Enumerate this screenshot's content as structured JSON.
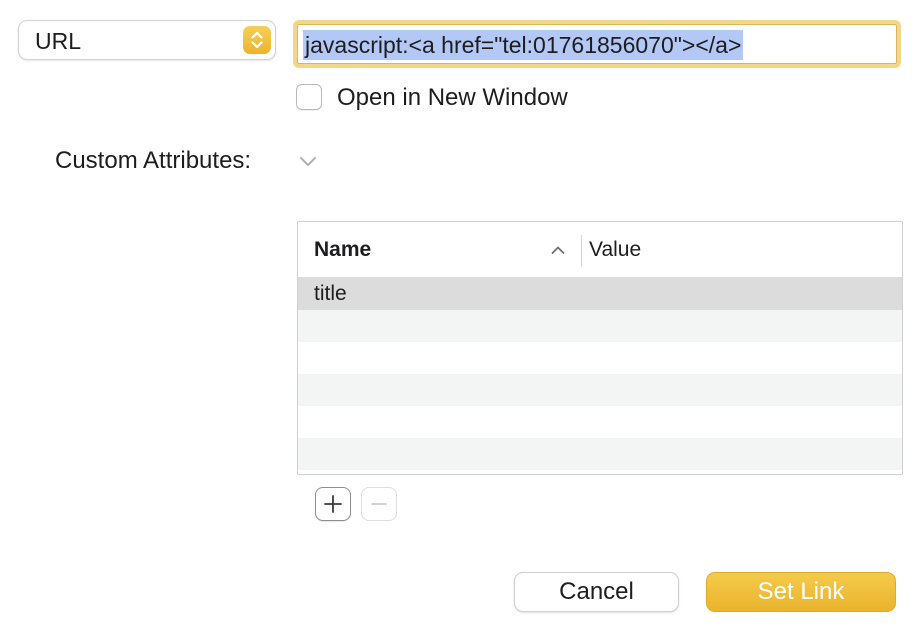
{
  "link_type": {
    "selected": "URL"
  },
  "url_field": {
    "value": "javascript:<a href=\"tel:01761856070\"></a>"
  },
  "open_in_new_window": {
    "label": "Open in New Window",
    "checked": false
  },
  "custom_attributes": {
    "label": "Custom Attributes:",
    "table": {
      "columns": [
        "Name",
        "Value"
      ],
      "sort_column": "Name",
      "sort_direction": "ascending",
      "rows": [
        {
          "name": "title",
          "value": "",
          "selected": true
        }
      ]
    }
  },
  "buttons": {
    "add": "+",
    "remove": "−",
    "cancel": "Cancel",
    "set_link": "Set Link"
  },
  "colors": {
    "accent": "#ebb52c",
    "selection_highlight": "#b3c8f5",
    "focus_ring": "#f3d58b"
  }
}
